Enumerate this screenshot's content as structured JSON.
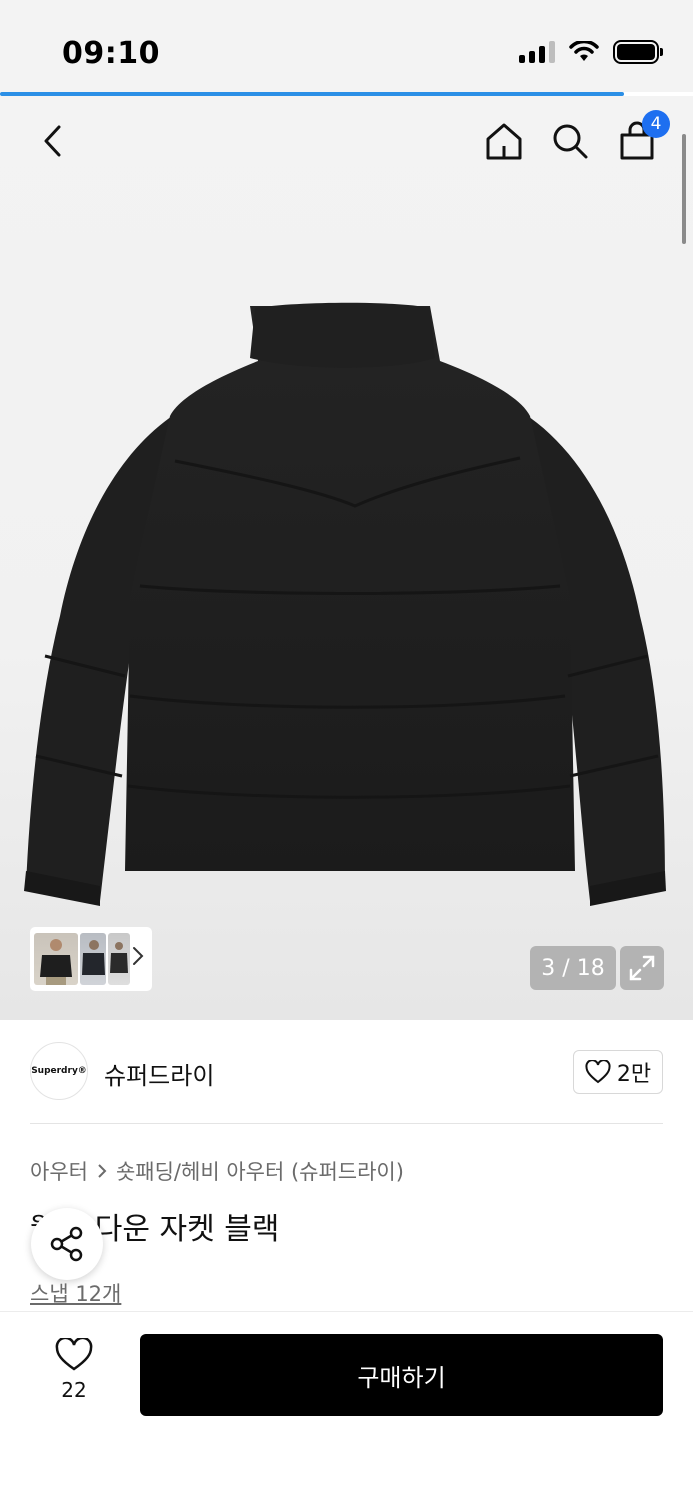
{
  "status_bar": {
    "time": "09:10"
  },
  "page_load_progress": 0.9,
  "nav": {
    "cart_count": "4"
  },
  "gallery": {
    "counter": "3 / 18"
  },
  "brand": {
    "logo_text": "Superdry®",
    "name": "슈퍼드라이",
    "like_count": "2만"
  },
  "breadcrumb": {
    "category": "아우터",
    "subcategory": "숏패딩/헤비 아우터 (슈퍼드라이)"
  },
  "product": {
    "title": "웰턴 다운 자켓 블랙",
    "snap_link": "스냅 12개"
  },
  "bottom_bar": {
    "wish_count": "22",
    "buy_label": "구매하기"
  },
  "colors": {
    "accent": "#1e6ff0",
    "progress": "#2b8fe6",
    "buy_button": "#000000"
  }
}
